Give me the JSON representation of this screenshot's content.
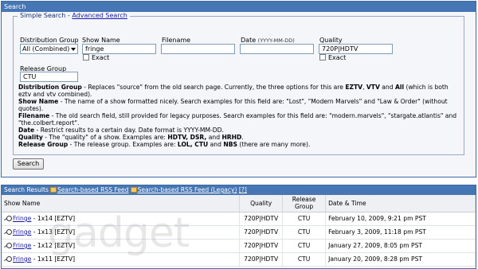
{
  "search_panel": {
    "header": "Search",
    "legend_simple": "Simple Search",
    "legend_sep": " - ",
    "legend_advanced": "Advanced Search",
    "distribution_group": {
      "label": "Distribution Group",
      "value": "All (Combined)"
    },
    "show_name": {
      "label": "Show Name",
      "value": "fringe",
      "exact_label": "Exact"
    },
    "filename": {
      "label": "Filename",
      "value": ""
    },
    "date": {
      "label": "Date",
      "hint": "(YYYY-MM-DD)",
      "value": ""
    },
    "quality": {
      "label": "Quality",
      "value": "720P|HDTV",
      "exact_label": "Exact"
    },
    "release_group": {
      "label": "Release Group",
      "value": "CTU"
    },
    "help": {
      "distribution_group": {
        "term": "Distribution Group",
        "text": " - Replaces \"source\" from the old search page. Currently, the three options for this are ",
        "b1": "EZTV",
        "t2": ", ",
        "b2": "VTV",
        "t3": " and ",
        "b3": "All",
        "t4": " (which is both eztv and vtv combined)."
      },
      "show_name": {
        "term": "Show Name",
        "text": " - The name of a show formatted nicely. Search examples for this field are: \"Lost\", \"Modern Marvels\" and \"Law & Order\" (without quotes)."
      },
      "filename": {
        "term": "Filename",
        "text": " - The old search field, still provided for legacy purposes. Search examples for this field are: \"modern.marvels\", \"stargate.atlantis\" and \"the.colbert.report\"."
      },
      "date": {
        "term": "Date",
        "text": " - Restrict results to a certain day. Date format is YYYY-MM-DD."
      },
      "quality": {
        "term": "Quality",
        "text": " - The \"quality\" of a show. Examples are: ",
        "b1": "HDTV, DSR,",
        "t2": " and ",
        "b2": "HRHD",
        "t3": "."
      },
      "release_group": {
        "term": "Release Group",
        "text": " - The release group. Examples are: ",
        "b1": "LOL, CTU",
        "t2": " and ",
        "b2": "NBS",
        "t3": " (there are many more)."
      }
    },
    "search_button": "Search"
  },
  "results": {
    "header_label": "Search Results",
    "rss_feed": "Search-based RSS Feed",
    "rss_legacy": "Search-based RSS Feed (Legacy)",
    "help_link": "[?]",
    "columns": {
      "show": "Show Name",
      "quality": "Quality",
      "release_1": "Release",
      "release_2": "Group",
      "date": "Date & Time"
    },
    "rows": [
      {
        "show": "Fringe",
        "episode": " - 1x14 [EZTV]",
        "quality": "720P|HDTV",
        "group": "CTU",
        "date": "February 10, 2009, 9:21 pm PST"
      },
      {
        "show": "Fringe",
        "episode": " - 1x13 [EZTV]",
        "quality": "720P|HDTV",
        "group": "CTU",
        "date": "February 3, 2009, 11:18 pm PST"
      },
      {
        "show": "Fringe",
        "episode": " - 1x12 [EZTV]",
        "quality": "720P|HDTV",
        "group": "CTU",
        "date": "January 27, 2009, 8:05 pm PST"
      },
      {
        "show": "Fringe",
        "episode": " - 1x11 [EZTV]",
        "quality": "720P|HDTV",
        "group": "CTU",
        "date": "January 20, 2009, 8:28 pm PST"
      }
    ]
  },
  "watermark": "gadget",
  "colors": {
    "header_blue": "#4776b4",
    "link": "#1a1aa6"
  }
}
